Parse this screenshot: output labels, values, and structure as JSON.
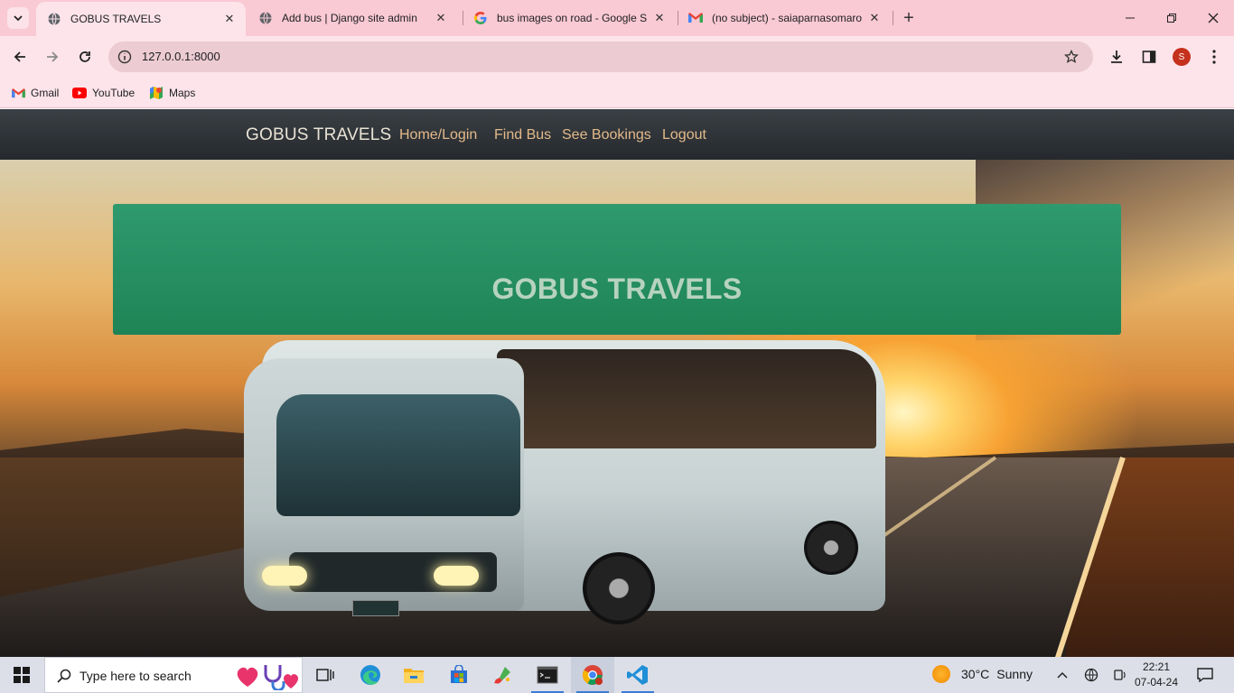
{
  "browser": {
    "tabs": [
      {
        "title": "GOBUS TRAVELS",
        "active": true,
        "favicon": "globe-icon"
      },
      {
        "title": "Add bus | Django site admin",
        "active": false,
        "favicon": "globe-icon"
      },
      {
        "title": "bus images on road - Google S",
        "active": false,
        "favicon": "google-icon"
      },
      {
        "title": "(no subject) - saiaparnasomaro",
        "active": false,
        "favicon": "gmail-icon"
      }
    ],
    "url": "127.0.0.1:8000",
    "profile_initial": "S",
    "bookmarks": [
      {
        "label": "Gmail",
        "icon": "gmail-icon"
      },
      {
        "label": "YouTube",
        "icon": "youtube-icon"
      },
      {
        "label": "Maps",
        "icon": "maps-icon"
      }
    ]
  },
  "site": {
    "brand": "GOBUS TRAVELS",
    "nav": [
      "Home/Login",
      "Find Bus",
      "See Bookings",
      "Logout"
    ],
    "hero_title": "GOBUS TRAVELS"
  },
  "taskbar": {
    "search_placeholder": "Type here to search",
    "weather": {
      "temp": "30°C",
      "condition": "Sunny"
    },
    "time": "22:21",
    "date": "07-04-24"
  }
}
